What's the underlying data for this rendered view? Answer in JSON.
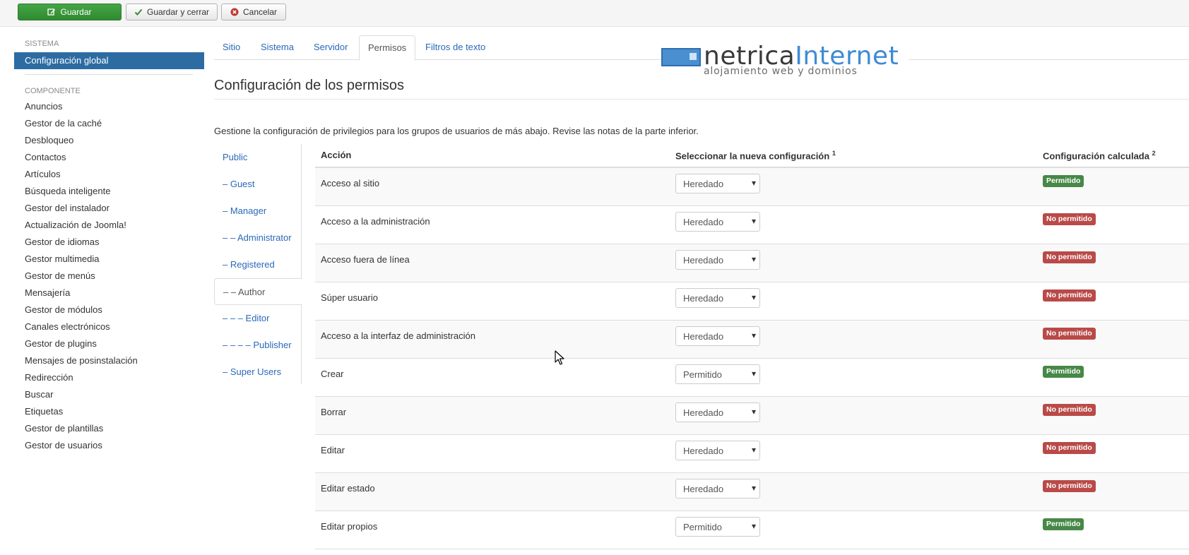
{
  "toolbar": {
    "save_label": "Guardar",
    "save_close_label": "Guardar y cerrar",
    "cancel_label": "Cancelar"
  },
  "sidebar": {
    "sistema_heading": "SISTEMA",
    "active_item": "Configuración global",
    "componente_heading": "COMPONENTE",
    "items": [
      "Anuncios",
      "Gestor de la caché",
      "Desbloqueo",
      "Contactos",
      "Artículos",
      "Búsqueda inteligente",
      "Gestor del instalador",
      "Actualización de Joomla!",
      "Gestor de idiomas",
      "Gestor multimedia",
      "Gestor de menús",
      "Mensajería",
      "Gestor de módulos",
      "Canales electrónicos",
      "Gestor de plugins",
      "Mensajes de posinstalación",
      "Redirección",
      "Buscar",
      "Etiquetas",
      "Gestor de plantillas",
      "Gestor de usuarios"
    ]
  },
  "tabs": [
    "Sitio",
    "Sistema",
    "Servidor",
    "Permisos",
    "Filtros de texto"
  ],
  "active_tab": "Permisos",
  "logo": {
    "word_dark": "netrica",
    "word_blue": "Internet",
    "tagline": "alojamiento web y dominios"
  },
  "main": {
    "title": "Configuración de los permisos",
    "intro": "Gestione la configuración de privilegios para los grupos de usuarios de más abajo. Revise las notas de la parte inferior."
  },
  "groups": [
    "Public",
    "– Guest",
    "– Manager",
    "– – Administrator",
    "– Registered",
    "– – Author",
    "– – – Editor",
    "– – – – Publisher",
    "– Super Users"
  ],
  "active_group": "– – Author",
  "table": {
    "col_action": "Acción",
    "col_select": "Seleccionar la nueva configuración",
    "col_select_note": "1",
    "col_calc": "Configuración calculada",
    "col_calc_note": "2",
    "rows": [
      {
        "action": "Acceso al sitio",
        "setting": "Heredado",
        "calculated": "Permitido",
        "allowed": true
      },
      {
        "action": "Acceso a la administración",
        "setting": "Heredado",
        "calculated": "No permitido",
        "allowed": false
      },
      {
        "action": "Acceso fuera de línea",
        "setting": "Heredado",
        "calculated": "No permitido",
        "allowed": false
      },
      {
        "action": "Súper usuario",
        "setting": "Heredado",
        "calculated": "No permitido",
        "allowed": false
      },
      {
        "action": "Acceso a la interfaz de administración",
        "setting": "Heredado",
        "calculated": "No permitido",
        "allowed": false
      },
      {
        "action": "Crear",
        "setting": "Permitido",
        "calculated": "Permitido",
        "allowed": true
      },
      {
        "action": "Borrar",
        "setting": "Heredado",
        "calculated": "No permitido",
        "allowed": false
      },
      {
        "action": "Editar",
        "setting": "Heredado",
        "calculated": "No permitido",
        "allowed": false
      },
      {
        "action": "Editar estado",
        "setting": "Heredado",
        "calculated": "No permitido",
        "allowed": false
      },
      {
        "action": "Editar propios",
        "setting": "Permitido",
        "calculated": "Permitido",
        "allowed": true
      }
    ]
  }
}
